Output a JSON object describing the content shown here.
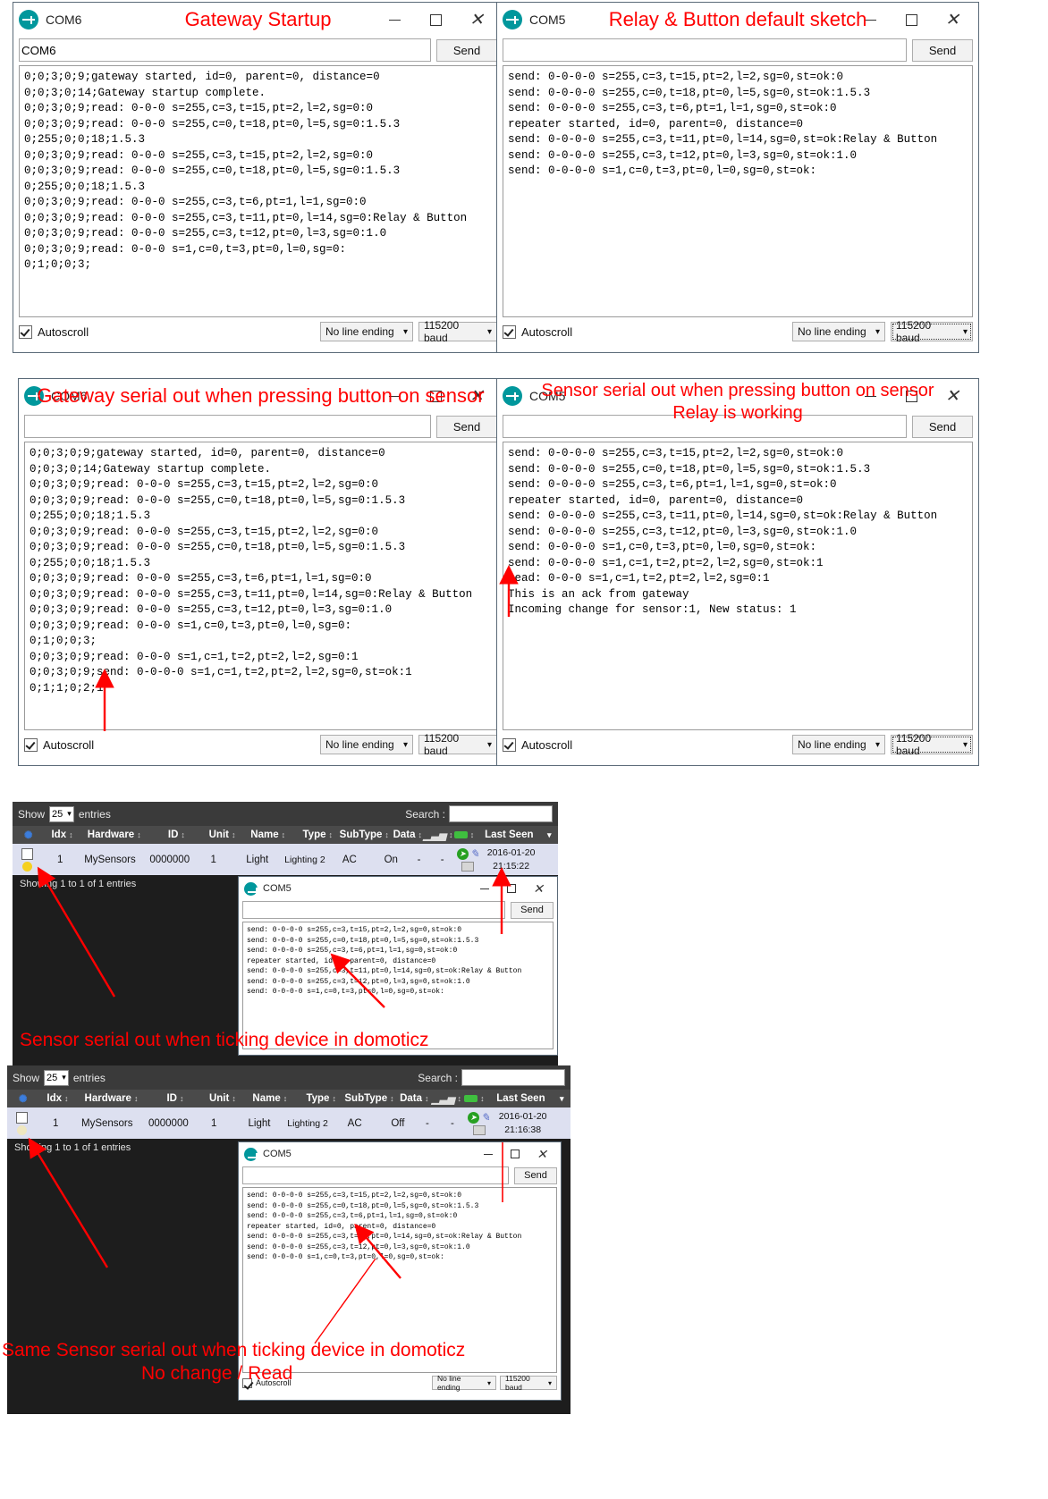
{
  "common": {
    "send_label": "Send",
    "autoscroll_label": "Autoscroll",
    "line_ending": "No line ending",
    "baud": "115200 baud",
    "input_placeholder": ""
  },
  "windows": {
    "gateway_startup": {
      "port": "COM6",
      "red_title": "Gateway Startup",
      "log": "0;0;3;0;9;gateway started, id=0, parent=0, distance=0\n0;0;3;0;14;Gateway startup complete.\n0;0;3;0;9;read: 0-0-0 s=255,c=3,t=15,pt=2,l=2,sg=0:0\n0;0;3;0;9;read: 0-0-0 s=255,c=0,t=18,pt=0,l=5,sg=0:1.5.3\n0;255;0;0;18;1.5.3\n0;0;3;0;9;read: 0-0-0 s=255,c=3,t=15,pt=2,l=2,sg=0:0\n0;0;3;0;9;read: 0-0-0 s=255,c=0,t=18,pt=0,l=5,sg=0:1.5.3\n0;255;0;0;18;1.5.3\n0;0;3;0;9;read: 0-0-0 s=255,c=3,t=6,pt=1,l=1,sg=0:0\n0;0;3;0;9;read: 0-0-0 s=255,c=3,t=11,pt=0,l=14,sg=0:Relay & Button\n0;0;3;0;9;read: 0-0-0 s=255,c=3,t=12,pt=0,l=3,sg=0:1.0\n0;0;3;0;9;read: 0-0-0 s=1,c=0,t=3,pt=0,l=0,sg=0:\n0;1;0;0;3;"
    },
    "relay_default": {
      "port": "COM5",
      "red_title": "Relay & Button default sketch",
      "log": "send: 0-0-0-0 s=255,c=3,t=15,pt=2,l=2,sg=0,st=ok:0\nsend: 0-0-0-0 s=255,c=0,t=18,pt=0,l=5,sg=0,st=ok:1.5.3\nsend: 0-0-0-0 s=255,c=3,t=6,pt=1,l=1,sg=0,st=ok:0\nrepeater started, id=0, parent=0, distance=0\nsend: 0-0-0-0 s=255,c=3,t=11,pt=0,l=14,sg=0,st=ok:Relay & Button\nsend: 0-0-0-0 s=255,c=3,t=12,pt=0,l=3,sg=0,st=ok:1.0\nsend: 0-0-0-0 s=1,c=0,t=3,pt=0,l=0,sg=0,st=ok:"
    },
    "gateway_button": {
      "port": "COM6",
      "red_title": "Gateway serial out when pressing button on sensor",
      "log": "0;0;3;0;9;gateway started, id=0, parent=0, distance=0\n0;0;3;0;14;Gateway startup complete.\n0;0;3;0;9;read: 0-0-0 s=255,c=3,t=15,pt=2,l=2,sg=0:0\n0;0;3;0;9;read: 0-0-0 s=255,c=0,t=18,pt=0,l=5,sg=0:1.5.3\n0;255;0;0;18;1.5.3\n0;0;3;0;9;read: 0-0-0 s=255,c=3,t=15,pt=2,l=2,sg=0:0\n0;0;3;0;9;read: 0-0-0 s=255,c=0,t=18,pt=0,l=5,sg=0:1.5.3\n0;255;0;0;18;1.5.3\n0;0;3;0;9;read: 0-0-0 s=255,c=3,t=6,pt=1,l=1,sg=0:0\n0;0;3;0;9;read: 0-0-0 s=255,c=3,t=11,pt=0,l=14,sg=0:Relay & Button\n0;0;3;0;9;read: 0-0-0 s=255,c=3,t=12,pt=0,l=3,sg=0:1.0\n0;0;3;0;9;read: 0-0-0 s=1,c=0,t=3,pt=0,l=0,sg=0:\n0;1;0;0;3;\n0;0;3;0;9;read: 0-0-0 s=1,c=1,t=2,pt=2,l=2,sg=0:1\n0;0;3;0;9;send: 0-0-0-0 s=1,c=1,t=2,pt=2,l=2,sg=0,st=ok:1\n0;1;1;0;2;1"
    },
    "sensor_button": {
      "port": "COM5",
      "red_title_line1": "Sensor serial out when pressing button on sensor",
      "red_title_line2": "Relay is working",
      "log": "send: 0-0-0-0 s=255,c=3,t=15,pt=2,l=2,sg=0,st=ok:0\nsend: 0-0-0-0 s=255,c=0,t=18,pt=0,l=5,sg=0,st=ok:1.5.3\nsend: 0-0-0-0 s=255,c=3,t=6,pt=1,l=1,sg=0,st=ok:0\nrepeater started, id=0, parent=0, distance=0\nsend: 0-0-0-0 s=255,c=3,t=11,pt=0,l=14,sg=0,st=ok:Relay & Button\nsend: 0-0-0-0 s=255,c=3,t=12,pt=0,l=3,sg=0,st=ok:1.0\nsend: 0-0-0-0 s=1,c=0,t=3,pt=0,l=0,sg=0,st=ok:\nsend: 0-0-0-0 s=1,c=1,t=2,pt=2,l=2,sg=0,st=ok:1\nread: 0-0-0 s=1,c=1,t=2,pt=2,l=2,sg=0:1\nThis is an ack from gateway\nIncoming change for sensor:1, New status: 1"
    },
    "com5_on": {
      "port": "COM5",
      "log": "send: 0-0-0-0 s=255,c=3,t=15,pt=2,l=2,sg=0,st=ok:0\nsend: 0-0-0-0 s=255,c=0,t=18,pt=0,l=5,sg=0,st=ok:1.5.3\nsend: 0-0-0-0 s=255,c=3,t=6,pt=1,l=1,sg=0,st=ok:0\nrepeater started, id=0, parent=0, distance=0\nsend: 0-0-0-0 s=255,c=3,t=11,pt=0,l=14,sg=0,st=ok:Relay & Button\nsend: 0-0-0-0 s=255,c=3,t=12,pt=0,l=3,sg=0,st=ok:1.0\nsend: 0-0-0-0 s=1,c=0,t=3,pt=0,l=0,sg=0,st=ok:"
    },
    "com5_off": {
      "port": "COM5",
      "log": "send: 0-0-0-0 s=255,c=3,t=15,pt=2,l=2,sg=0,st=ok:0\nsend: 0-0-0-0 s=255,c=0,t=18,pt=0,l=5,sg=0,st=ok:1.5.3\nsend: 0-0-0-0 s=255,c=3,t=6,pt=1,l=1,sg=0,st=ok:0\nrepeater started, id=0, parent=0, distance=0\nsend: 0-0-0-0 s=255,c=3,t=11,pt=0,l=14,sg=0,st=ok:Relay & Button\nsend: 0-0-0-0 s=255,c=3,t=12,pt=0,l=3,sg=0,st=ok:1.0\nsend: 0-0-0-0 s=1,c=0,t=3,pt=0,l=0,sg=0,st=ok:"
    }
  },
  "domoticz": {
    "show_label": "Show",
    "show_value": "25",
    "entries_label": "entries",
    "search_label": "Search :",
    "search_value": "",
    "columns": [
      "Idx",
      "Hardware",
      "ID",
      "Unit",
      "Name",
      "Type",
      "SubType",
      "Data",
      "signal",
      "battery",
      "Last Seen"
    ],
    "table_on": {
      "idx": "1",
      "hardware": "MySensors",
      "id": "0000000",
      "unit": "1",
      "name": "Light",
      "type": "Lighting 2",
      "subtype": "AC",
      "data": "On",
      "signal": "-",
      "battery": "-",
      "last_seen_date": "2016-01-20",
      "last_seen_time": "21:15:22",
      "footer": "Showing 1 to 1 of 1 entries"
    },
    "table_off": {
      "idx": "1",
      "hardware": "MySensors",
      "id": "0000000",
      "unit": "1",
      "name": "Light",
      "type": "Lighting 2",
      "subtype": "AC",
      "data": "Off",
      "signal": "-",
      "battery": "-",
      "last_seen_date": "2016-01-20",
      "last_seen_time": "21:16:38",
      "footer": "Showing 1 to 1 of 1 entries"
    }
  },
  "captions": {
    "caption_ticking": "Sensor serial out when ticking device in domoticz",
    "caption_same_line1": "Same Sensor serial out when ticking device in domoticz",
    "caption_same_line2": "No change / Read"
  },
  "colors": {
    "annotation_red": "#ff0000",
    "arduino_teal": "#00979c",
    "table_row_bg": "#dde0f0",
    "domoticz_dark": "#1d1d1d"
  }
}
